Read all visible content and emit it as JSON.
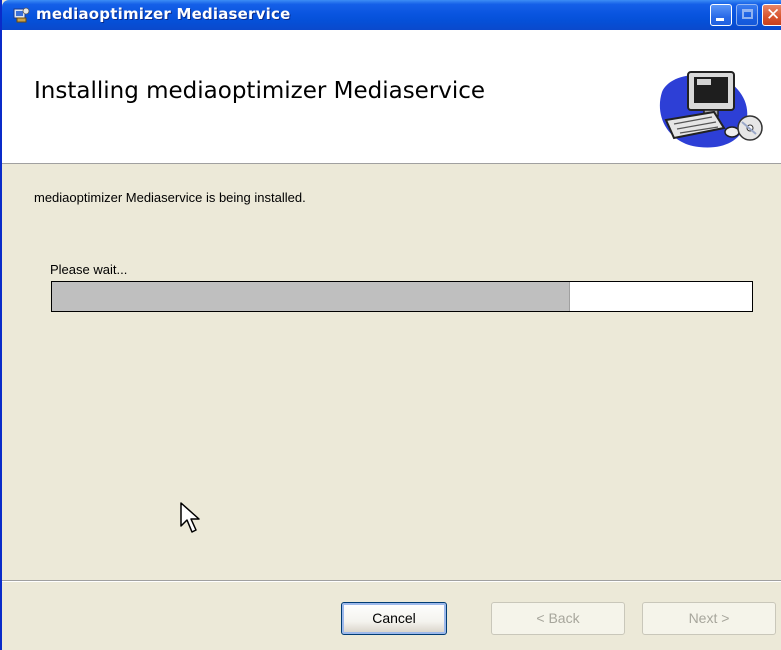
{
  "window": {
    "title": "mediaoptimizer Mediaservice"
  },
  "title_buttons": {
    "minimize": "minimize-icon",
    "maximize": "maximize-icon",
    "close": "close-icon"
  },
  "header": {
    "title": "Installing mediaoptimizer Mediaservice",
    "image": "computer-installer-icon"
  },
  "body": {
    "status_text": "mediaoptimizer Mediaservice is being installed.",
    "wait_text": "Please wait...",
    "progress_fraction": 0.74
  },
  "buttons": {
    "cancel": "Cancel",
    "back": "< Back",
    "next": "Next >"
  },
  "colors": {
    "titlebar": "#0A55E0",
    "progress_fill": "#BFBFBF",
    "dialog_bg": "#ECE9D8"
  }
}
